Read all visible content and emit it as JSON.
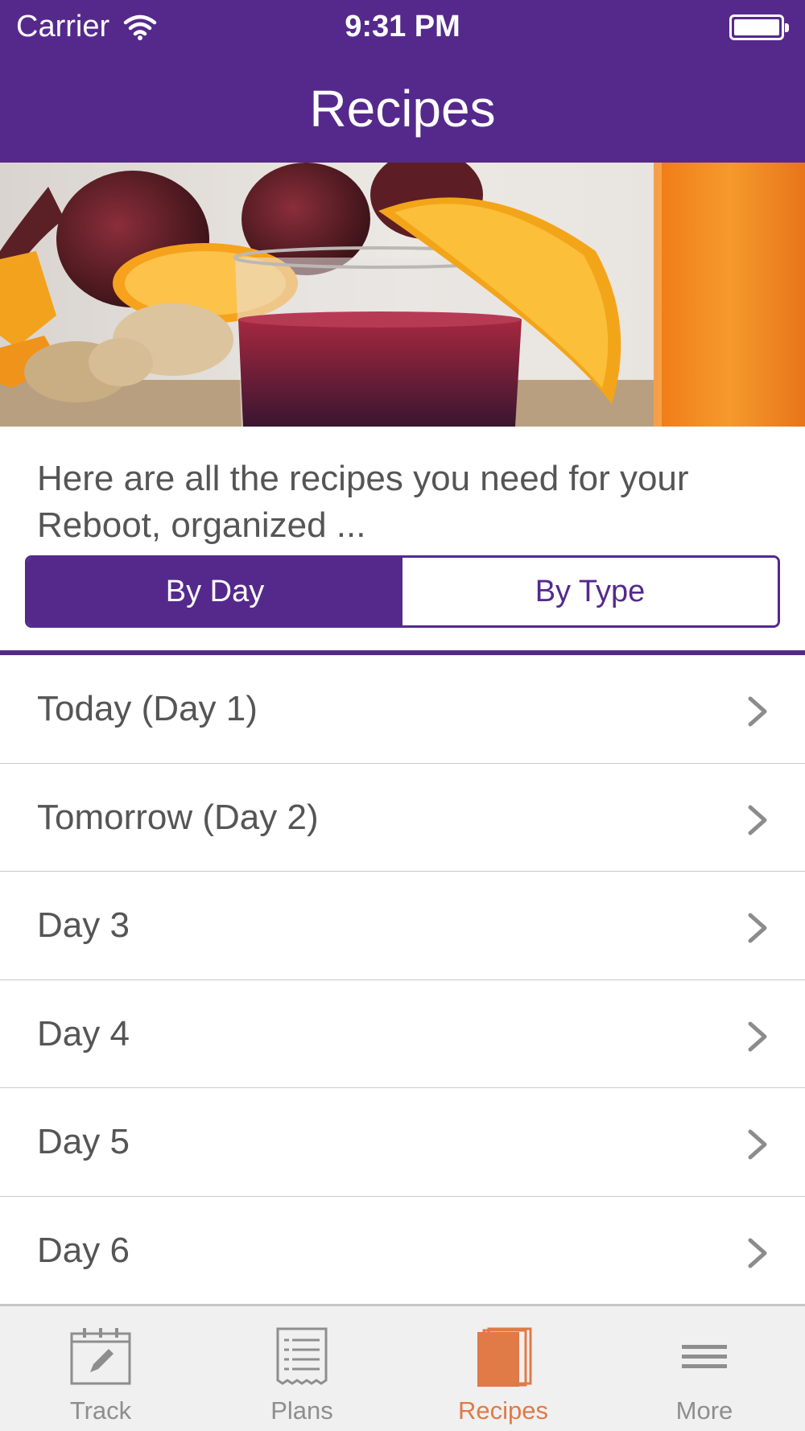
{
  "status_bar": {
    "carrier": "Carrier",
    "time": "9:31 PM"
  },
  "nav": {
    "title": "Recipes"
  },
  "intro": {
    "text": "Here are all the recipes you need for your Reboot, organized ..."
  },
  "segment": {
    "options": [
      "By Day",
      "By Type"
    ],
    "selected": "By Day"
  },
  "list": {
    "items": [
      {
        "label": "Today (Day 1)"
      },
      {
        "label": "Tomorrow (Day 2)"
      },
      {
        "label": "Day 3"
      },
      {
        "label": "Day 4"
      },
      {
        "label": "Day 5"
      },
      {
        "label": "Day 6"
      }
    ]
  },
  "tabbar": {
    "items": [
      {
        "label": "Track",
        "icon": "calendar-pencil-icon"
      },
      {
        "label": "Plans",
        "icon": "receipt-list-icon"
      },
      {
        "label": "Recipes",
        "icon": "book-icon"
      },
      {
        "label": "More",
        "icon": "hamburger-menu-icon"
      }
    ],
    "active": "Recipes"
  },
  "colors": {
    "brand_purple": "#55298c",
    "active_tab": "#e07a47",
    "text_gray": "#555555"
  }
}
